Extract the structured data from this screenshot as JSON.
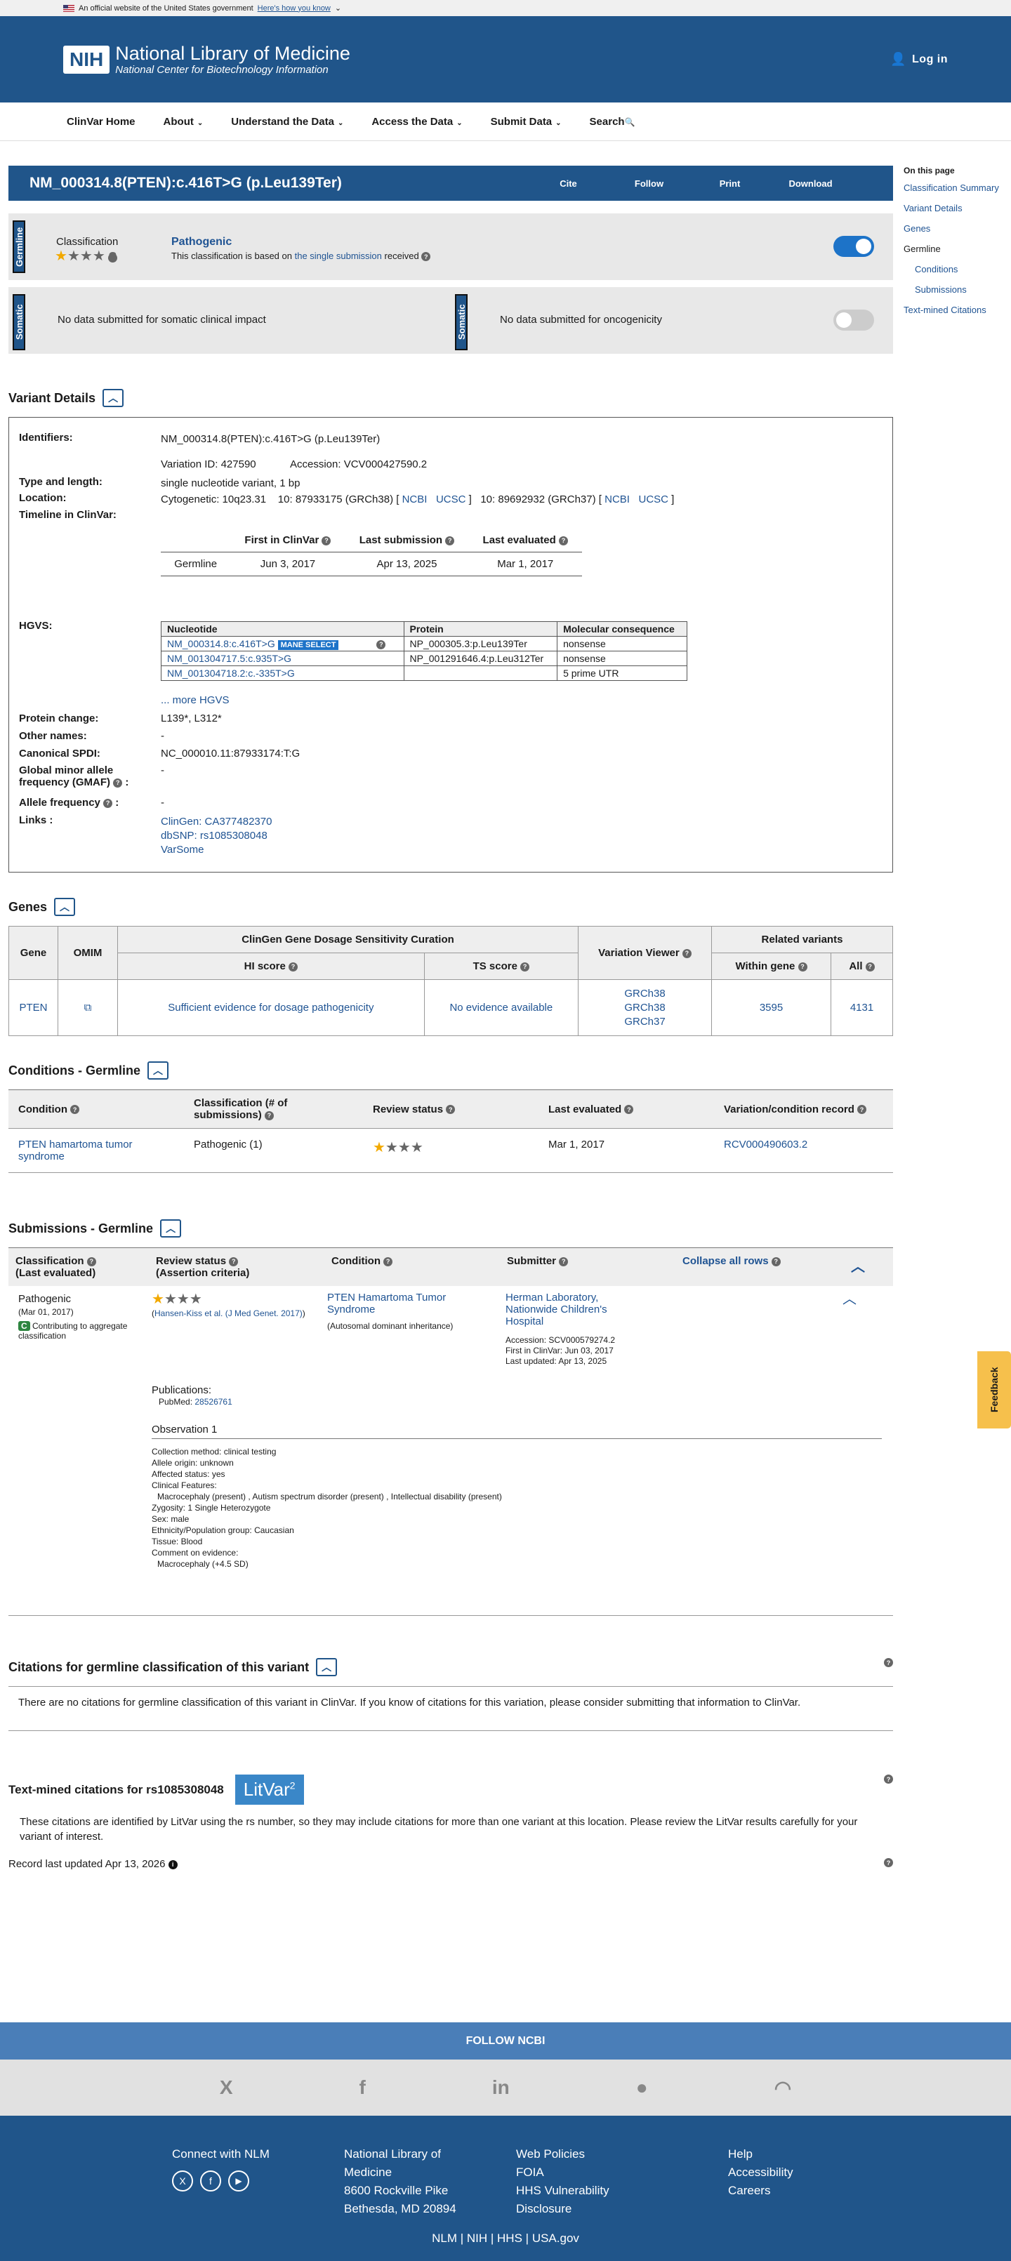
{
  "gov_banner": {
    "text": "An official website of the United States government",
    "link": "Here's how you know"
  },
  "header": {
    "logo": "NIH",
    "title": "National Library of Medicine",
    "subtitle": "National Center for Biotechnology Information",
    "login": "Log in"
  },
  "nav": [
    "ClinVar Home",
    "About",
    "Understand the Data",
    "Access the Data",
    "Submit Data",
    "Search"
  ],
  "title": {
    "text": "NM_000314.8(PTEN):c.416T>G (p.Leu139Ter)",
    "actions": [
      "Cite",
      "Follow",
      "Print",
      "Download"
    ]
  },
  "sidebar": {
    "heading": "On this page",
    "items": [
      "Classification Summary",
      "Variant Details",
      "Genes",
      "Germline",
      "Conditions",
      "Submissions",
      "Text-mined Citations"
    ]
  },
  "germline": {
    "tab": "Germline",
    "label": "Classification",
    "value": "Pathogenic",
    "note_pre": "This classification is based on",
    "note_link": "the single submission",
    "note_post": "received",
    "stars": 1
  },
  "somatic": {
    "tab": "Somatic",
    "clinical": "No data submitted for somatic clinical impact",
    "onco": "No data submitted for oncogenicity"
  },
  "variant": {
    "heading": "Variant Details",
    "identifiers_label": "Identifiers:",
    "identifier": "NM_000314.8(PTEN):c.416T>G (p.Leu139Ter)",
    "variation_id": "Variation ID: 427590",
    "accession": "Accession: VCV000427590.2",
    "type_label": "Type and length:",
    "type": "single nucleotide variant, 1 bp",
    "location_label": "Location:",
    "cyto": "Cytogenetic: 10q23.31",
    "loc38": "10: 87933175 (GRCh38) [",
    "loc37": "10: 89692932 (GRCh37) [",
    "ncbi": "NCBI",
    "ucsc": "UCSC",
    "close": "]",
    "timeline_label": "Timeline in ClinVar:",
    "timeline_headers": [
      "First in ClinVar",
      "Last submission",
      "Last evaluated"
    ],
    "timeline_row": [
      "Germline",
      "Jun 3, 2017",
      "Apr 13, 2025",
      "Mar 1, 2017"
    ],
    "hgvs_label": "HGVS:",
    "hgvs_headers": [
      "Nucleotide",
      "Protein",
      "Molecular consequence"
    ],
    "hgvs_rows": [
      [
        "NM_000314.8:c.416T>G",
        "NP_000305.3:p.Leu139Ter",
        "nonsense"
      ],
      [
        "NM_001304717.5:c.935T>G",
        "NP_001291646.4:p.Leu312Ter",
        "nonsense"
      ],
      [
        "NM_001304718.2:c.-335T>G",
        "",
        "5 prime UTR"
      ]
    ],
    "mane": "MANE SELECT",
    "more_hgvs": "... more HGVS",
    "protein_label": "Protein change:",
    "protein": "L139*, L312*",
    "other_label": "Other names:",
    "other": "-",
    "spdi_label": "Canonical SPDI:",
    "spdi": "NC_000010.11:87933174:T:G",
    "gmaf_label": "Global minor allele frequency (GMAF)",
    "gmaf": "-",
    "af_label": "Allele frequency",
    "af": "-",
    "links_label": "Links :",
    "links": [
      "ClinGen: CA377482370",
      "dbSNP: rs1085308048",
      "VarSome"
    ]
  },
  "genes": {
    "heading": "Genes",
    "h_gene": "Gene",
    "h_omim": "OMIM",
    "h_clingen": "ClinGen Gene Dosage Sensitivity Curation",
    "h_viewer": "Variation Viewer",
    "h_related": "Related variants",
    "h_hi": "HI score",
    "h_ts": "TS score",
    "h_within": "Within gene",
    "h_all": "All",
    "gene": "PTEN",
    "hi": "Sufficient evidence for dosage pathogenicity",
    "ts": "No evidence available",
    "viewer": [
      "GRCh38",
      "GRCh38",
      "GRCh37"
    ],
    "within": "3595",
    "all": "4131"
  },
  "conditions": {
    "heading": "Conditions - Germline",
    "headers": [
      "Condition",
      "Classification (# of submissions)",
      "Review status",
      "Last evaluated",
      "Variation/condition record"
    ],
    "row": {
      "condition": "PTEN hamartoma tumor syndrome",
      "classification": "Pathogenic (1)",
      "last": "Mar 1, 2017",
      "record": "RCV000490603.2"
    }
  },
  "submissions": {
    "heading": "Submissions - Germline",
    "h_class": "Classification",
    "h_class2": "(Last evaluated)",
    "h_review": "Review status",
    "h_review2": "(Assertion criteria)",
    "h_cond": "Condition",
    "h_sub": "Submitter",
    "collapse": "Collapse all rows",
    "cls": "Pathogenic",
    "cls_date": "(Mar 01, 2017)",
    "contrib_badge": "C",
    "contrib": "Contributing to aggregate classification",
    "criteria": "Hansen-Kiss et al. (J Med Genet. 2017)",
    "cond": "PTEN Hamartoma Tumor Syndrome",
    "inherit": "(Autosomal dominant inheritance)",
    "submitter": "Herman Laboratory, Nationwide Children's Hospital",
    "sub_acc": "Accession: SCV000579274.2",
    "sub_first": "First in ClinVar: Jun 03, 2017",
    "sub_updated": "Last updated: Apr 13, 2025",
    "pubs": "Publications:",
    "pubmed_label": "PubMed:",
    "pubmed": "28526761",
    "obs_title": "Observation 1",
    "obs": [
      "Collection method: clinical testing",
      "Allele origin: unknown",
      "Affected status: yes",
      "Clinical Features:",
      "Macrocephaly (present) , Autism spectrum disorder (present) , Intellectual disability (present)",
      "Zygosity: 1 Single Heterozygote",
      "Sex: male",
      "Ethnicity/Population group: Caucasian",
      "Tissue: Blood",
      "Comment on evidence:",
      "Macrocephaly (+4.5 SD)"
    ]
  },
  "citations": {
    "heading": "Citations for germline classification of this variant",
    "text": "There are no citations for germline classification of this variant in ClinVar. If you know of citations for this variation, please consider submitting that information to ClinVar."
  },
  "textmined": {
    "heading": "Text-mined citations for rs1085308048",
    "badge": "LitVar",
    "badge_sup": "2",
    "text": "These citations are identified by LitVar using the rs number, so they may include citations for more than one variant at this location. Please review the LitVar results carefully for your variant of interest."
  },
  "record_updated": "Record last updated Apr 13, 2026",
  "feedback": "Feedback",
  "footer": {
    "follow": "FOLLOW NCBI",
    "social": [
      "X",
      "f",
      "in",
      "GH",
      "RSS"
    ],
    "connect": "Connect with NLM",
    "nlm": [
      "National Library of",
      "Medicine",
      "8600 Rockville Pike",
      "Bethesda, MD 20894"
    ],
    "policies": [
      "Web Policies",
      "FOIA",
      "HHS Vulnerability",
      "Disclosure"
    ],
    "help": [
      "Help",
      "Accessibility",
      "Careers"
    ],
    "bottom": [
      "NLM",
      "NIH",
      "HHS",
      "USA.gov"
    ]
  }
}
